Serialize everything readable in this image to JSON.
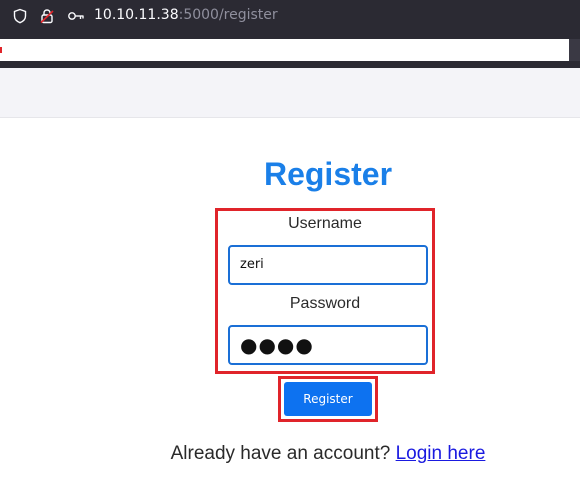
{
  "browser": {
    "url_host": "10.10.11.38",
    "url_rest": ":5000/register",
    "icons": [
      "shield-icon",
      "lock-icon",
      "key-icon"
    ]
  },
  "page": {
    "title": "Register",
    "username_label": "Username",
    "username_value": "zeri",
    "password_label": "Password",
    "password_value": "●●●●",
    "submit_label": "Register",
    "footer_text": "Already have an account? ",
    "login_link": "Login here"
  },
  "colors": {
    "accent": "#1a7fe8",
    "button": "#0d72f0",
    "highlight": "#e0242a",
    "link": "#1a1ae0"
  }
}
